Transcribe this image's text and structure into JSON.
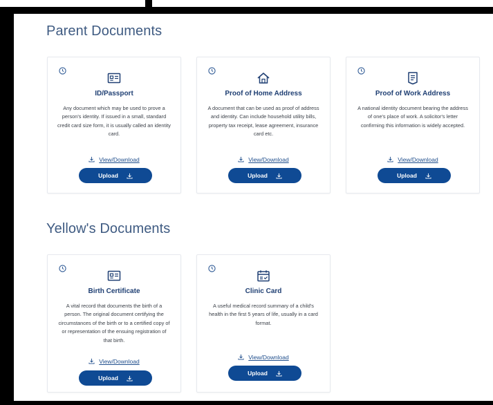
{
  "sections": [
    {
      "title": "Parent Documents",
      "cards": [
        {
          "title": "ID/Passport",
          "icon": "id-card-icon",
          "description": "Any document which may be used to prove a person's identity. If issued in a small, standard credit card size form, it is usually called an identity card.",
          "view_label": "View/Download",
          "upload_label": "Upload"
        },
        {
          "title": "Proof of Home Address",
          "icon": "home-icon",
          "description": "A document that can be used as proof of address and identity. Can include household utility bills, property tax receipt, lease agreement, insurance card etc.",
          "view_label": "View/Download",
          "upload_label": "Upload"
        },
        {
          "title": "Proof of Work Address",
          "icon": "document-icon",
          "description": "A national identity document bearing the address of one's place of work. A solicitor's letter confirming this information is widely accepted.",
          "view_label": "View/Download",
          "upload_label": "Upload"
        }
      ]
    },
    {
      "title": "Yellow's Documents",
      "cards": [
        {
          "title": "Birth Certificate",
          "icon": "id-card-icon",
          "description": "A vital record that documents the birth of a person. The original document certifying the circumstances of the birth or to a certified copy of or representation of the ensuing registration of that birth.",
          "view_label": "View/Download",
          "upload_label": "Upload"
        },
        {
          "title": "Clinic Card",
          "icon": "calendar-check-icon",
          "description": "A useful medical record summary of a child's health in the first 5 years of life, usually in a card format.",
          "view_label": "View/Download",
          "upload_label": "Upload"
        }
      ]
    }
  ],
  "colors": {
    "section_title": "#3f5b82",
    "card_title": "#1f3f73",
    "button": "#0f4a94",
    "link": "#1f4e8c",
    "card_border": "#e6e9ee"
  }
}
